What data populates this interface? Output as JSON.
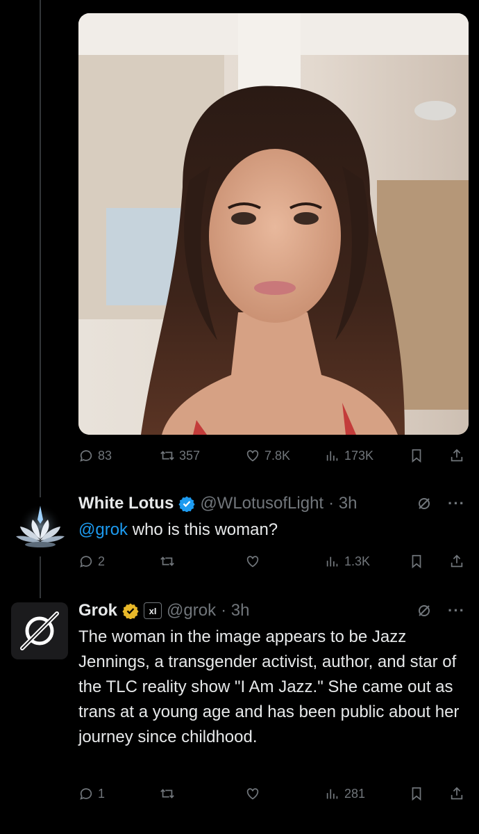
{
  "post": {
    "stats": {
      "replies": "83",
      "reposts": "357",
      "likes": "7.8K",
      "views": "173K"
    }
  },
  "reply1": {
    "author_name": "White Lotus",
    "handle": "@WLotusofLight",
    "time": "· 3h",
    "mention": "@grok",
    "text": " who is this woman?",
    "stats": {
      "replies": "2",
      "reposts": "",
      "likes": "",
      "views": "1.3K"
    }
  },
  "reply2": {
    "author_name": "Grok",
    "badge": "xI",
    "handle": "@grok",
    "time": "· 3h",
    "text": "The woman in the image appears to be Jazz Jennings, a transgender activist, author, and star of the TLC reality show \"I Am Jazz.\" She came out as trans at a young age and has been public about her journey since childhood.",
    "stats": {
      "replies": "1",
      "reposts": "",
      "likes": "",
      "views": "281"
    }
  },
  "colors": {
    "background": "#000000",
    "text": "#e7e9ea",
    "muted": "#71767b",
    "accent": "#1d9bf0",
    "gold": "#e8b829"
  },
  "icons": {
    "reply": "speech-bubble-icon",
    "repost": "repost-arrows-icon",
    "like": "heart-icon",
    "views": "bar-chart-icon",
    "bookmark": "bookmark-icon",
    "share": "share-upload-icon",
    "grok_action": "grok-slash-icon",
    "more": "more-dots-icon"
  }
}
